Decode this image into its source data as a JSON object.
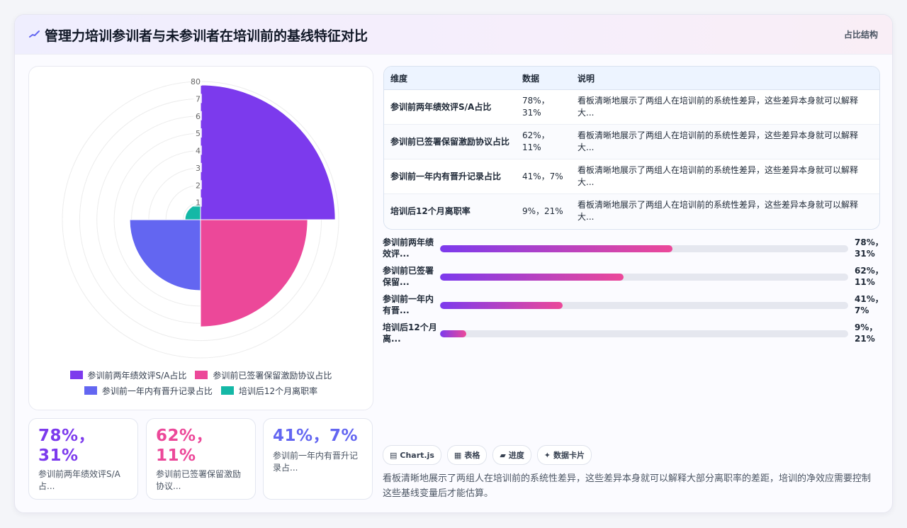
{
  "header": {
    "title": "管理力培训参训者与未参训者在培训前的基线特征对比",
    "tag": "占比结构"
  },
  "chart_data": {
    "type": "polarArea",
    "categories": [
      "参训前两年绩效评S/A占比",
      "参训前已签署保留激励协议占比",
      "参训前一年内有晋升记录占比",
      "培训后12个月离职率"
    ],
    "values": [
      78,
      62,
      41,
      9
    ],
    "colors": [
      "#7c3aed",
      "#ec4899",
      "#6366f1",
      "#14b8a6"
    ],
    "r_ticks": [
      "1",
      "2",
      "3",
      "4",
      "5",
      "6",
      "7",
      "80"
    ],
    "r_max": 80,
    "legend_position": "bottom"
  },
  "legend": [
    {
      "label": "参训前两年绩效评S/A占比",
      "color": "#7c3aed"
    },
    {
      "label": "参训前已签署保留激励协议占比",
      "color": "#ec4899"
    },
    {
      "label": "参训前一年内有晋升记录占比",
      "color": "#6366f1"
    },
    {
      "label": "培训后12个月离职率",
      "color": "#14b8a6"
    }
  ],
  "stat_cards": [
    {
      "value": "78%，31%",
      "label": "参训前两年绩效评S/A占...",
      "color": "#7c3aed"
    },
    {
      "value": "62%，11%",
      "label": "参训前已签署保留激励协议...",
      "color": "#ec4899"
    },
    {
      "value": "41%，7%",
      "label": "参训前一年内有晋升记录占...",
      "color": "#6366f1"
    }
  ],
  "table": {
    "headers": [
      "维度",
      "数据",
      "说明"
    ],
    "rows": [
      {
        "dim": "参训前两年绩效评S/A占比",
        "data": "78%，31%",
        "desc": "看板清晰地展示了两组人在培训前的系统性差异，这些差异本身就可以解释大..."
      },
      {
        "dim": "参训前已签署保留激励协议占比",
        "data": "62%，11%",
        "desc": "看板清晰地展示了两组人在培训前的系统性差异，这些差异本身就可以解释大..."
      },
      {
        "dim": "参训前一年内有晋升记录占比",
        "data": "41%，7%",
        "desc": "看板清晰地展示了两组人在培训前的系统性差异，这些差异本身就可以解释大..."
      },
      {
        "dim": "培训后12个月离职率",
        "data": "9%，21%",
        "desc": "看板清晰地展示了两组人在培训前的系统性差异，这些差异本身就可以解释大..."
      }
    ]
  },
  "progress": [
    {
      "label": "参训前两年绩效评...",
      "value": "78%，31%",
      "fraction": 0.57
    },
    {
      "label": "参训前已签署保留...",
      "value": "62%，11%",
      "fraction": 0.45
    },
    {
      "label": "参训前一年内有晋...",
      "value": "41%，7%",
      "fraction": 0.3
    },
    {
      "label": "培训后12个月离...",
      "value": "9%，21%",
      "fraction": 0.065
    }
  ],
  "tech_tags": [
    {
      "icon": "▤",
      "label": "Chart.js"
    },
    {
      "icon": "▦",
      "label": "表格"
    },
    {
      "icon": "▰",
      "label": "进度"
    },
    {
      "icon": "✦",
      "label": "数据卡片"
    }
  ],
  "summary": "看板清晰地展示了两组人在培训前的系统性差异，这些差异本身就可以解释大部分离职率的差距，培训的净效应需要控制这些基线变量后才能估算。"
}
